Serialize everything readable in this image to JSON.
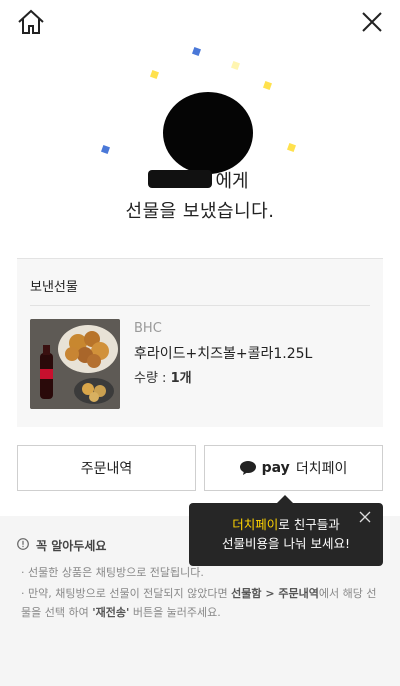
{
  "header": {
    "home_icon": "home-icon",
    "close_icon": "close-icon"
  },
  "message": {
    "line1_suffix": "에게",
    "line2": "선물을 보냈습니다."
  },
  "gift": {
    "section_title": "보낸선물",
    "brand": "BHC",
    "product_name": "후라이드+치즈볼+콜라1.25L",
    "quantity_label": "수량 : ",
    "quantity_value": "1개"
  },
  "buttons": {
    "orders_label": "주문내역",
    "pay_logo": "pay",
    "pay_label": "더치페이"
  },
  "tooltip": {
    "highlight": "더치페이",
    "text_after_highlight": "로 친구들과",
    "line2": "선물비용을 나눠 보세요!"
  },
  "notice": {
    "title": "꼭 알아두세요",
    "note1": "선물한 상품은 채팅방으로 전달됩니다.",
    "note2_part1": "만약, 채팅방으로 선물이 전달되지 않았다면 ",
    "note2_bold1": "선물함 > 주문내역",
    "note2_part2": "에서 해당 선물을 선택 하여 ",
    "note2_bold2": "'재전송'",
    "note2_part3": " 버튼을 눌러주세요."
  },
  "colors": {
    "accent_yellow": "#ffd400",
    "tooltip_bg": "#262626",
    "confetti_yellow": "#ffe14d",
    "confetti_blue": "#4a78d8"
  }
}
